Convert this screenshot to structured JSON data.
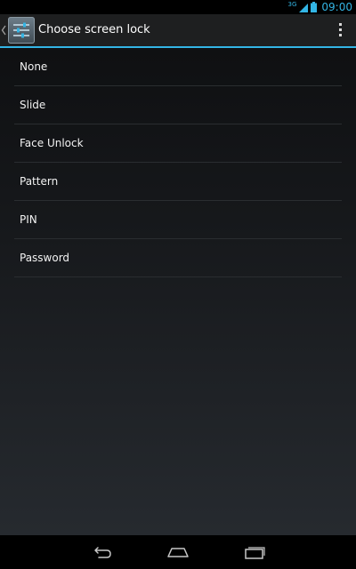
{
  "status_bar": {
    "network_label": "3G",
    "clock": "09:00",
    "accent_color": "#33b5e5"
  },
  "action_bar": {
    "title": "Choose screen lock",
    "up_icon": "chevron-left-icon",
    "app_icon": "settings-icon",
    "overflow_icon": "overflow-menu-icon",
    "accent_color": "#33b5e5"
  },
  "lock_options": [
    {
      "label": "None"
    },
    {
      "label": "Slide"
    },
    {
      "label": "Face Unlock"
    },
    {
      "label": "Pattern"
    },
    {
      "label": "PIN"
    },
    {
      "label": "Password"
    }
  ],
  "nav_bar": {
    "back_icon": "back-icon",
    "home_icon": "home-icon",
    "recents_icon": "recent-apps-icon"
  }
}
